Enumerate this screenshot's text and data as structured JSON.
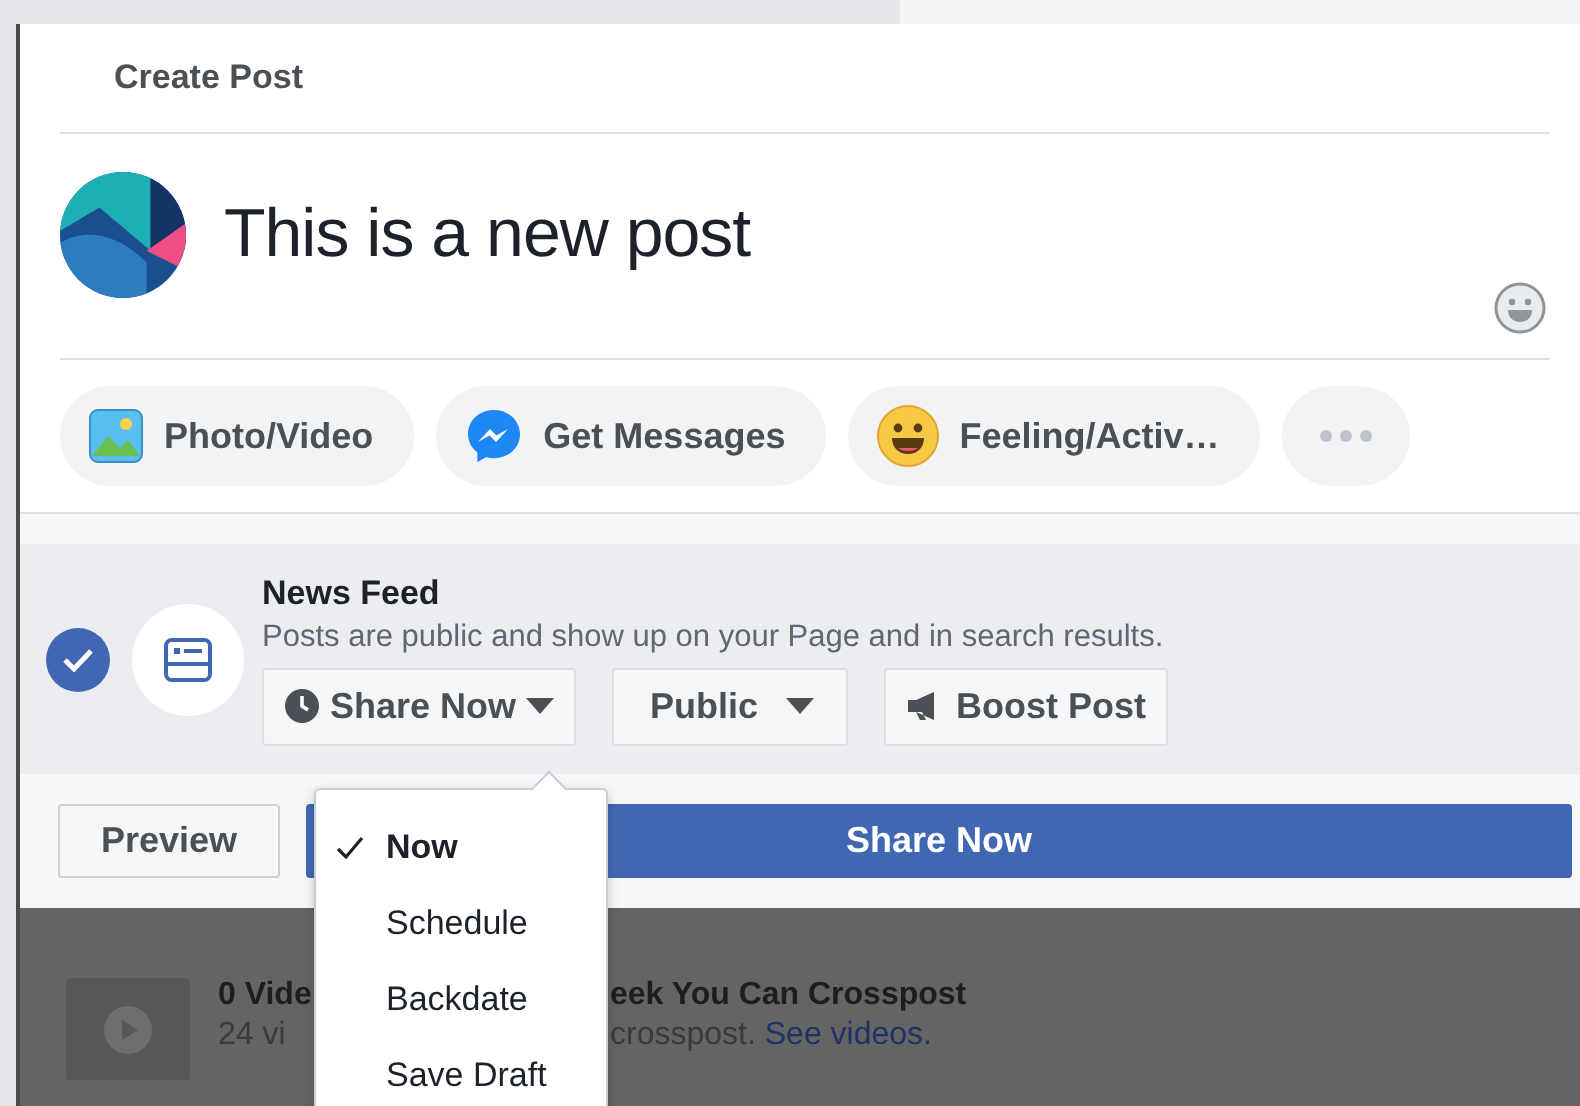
{
  "dialog": {
    "title": "Create Post"
  },
  "composer": {
    "text": "This is a new post"
  },
  "actions": [
    {
      "kind": "photo",
      "label": "Photo/Video"
    },
    {
      "kind": "messenger",
      "label": "Get Messages"
    },
    {
      "kind": "feeling",
      "label": "Feeling/Activ…"
    },
    {
      "kind": "more"
    }
  ],
  "audience": {
    "checked": true,
    "title": "News Feed",
    "description": "Posts are public and show up on your Page and in search results.",
    "buttons": [
      {
        "kind": "schedule",
        "label": "Share Now"
      },
      {
        "kind": "privacy",
        "label": "Public"
      },
      {
        "kind": "boost",
        "label": "Boost Post"
      }
    ]
  },
  "footer": {
    "preview": "Preview",
    "submit": "Share Now"
  },
  "schedule_menu": [
    {
      "label": "Now",
      "selected": true
    },
    {
      "label": "Schedule",
      "selected": false
    },
    {
      "label": "Backdate",
      "selected": false
    },
    {
      "label": "Save Draft",
      "selected": false
    }
  ],
  "background_card": {
    "title_parts": [
      "0 Vide",
      "eek You Can Crosspost"
    ],
    "description_parts": [
      "24 vi",
      "crosspost."
    ],
    "link": "See videos."
  }
}
